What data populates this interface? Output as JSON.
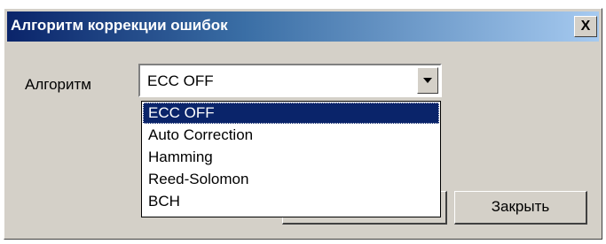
{
  "window": {
    "title": "Алгоритм коррекции ошибок",
    "close_glyph": "X",
    "title_gradient": [
      "#0a246a",
      "#a6caf0"
    ]
  },
  "form": {
    "algorithm_label": "Алгоритм",
    "algorithm_selected": "ECC OFF"
  },
  "dropdown": {
    "options": [
      "ECC OFF",
      "Auto Correction",
      "Hamming",
      "Reed-Solomon",
      "BCH"
    ],
    "highlighted": "ECC OFF",
    "highlight_color": "#0a246a"
  },
  "buttons": {
    "close_label": "Закрыть"
  }
}
